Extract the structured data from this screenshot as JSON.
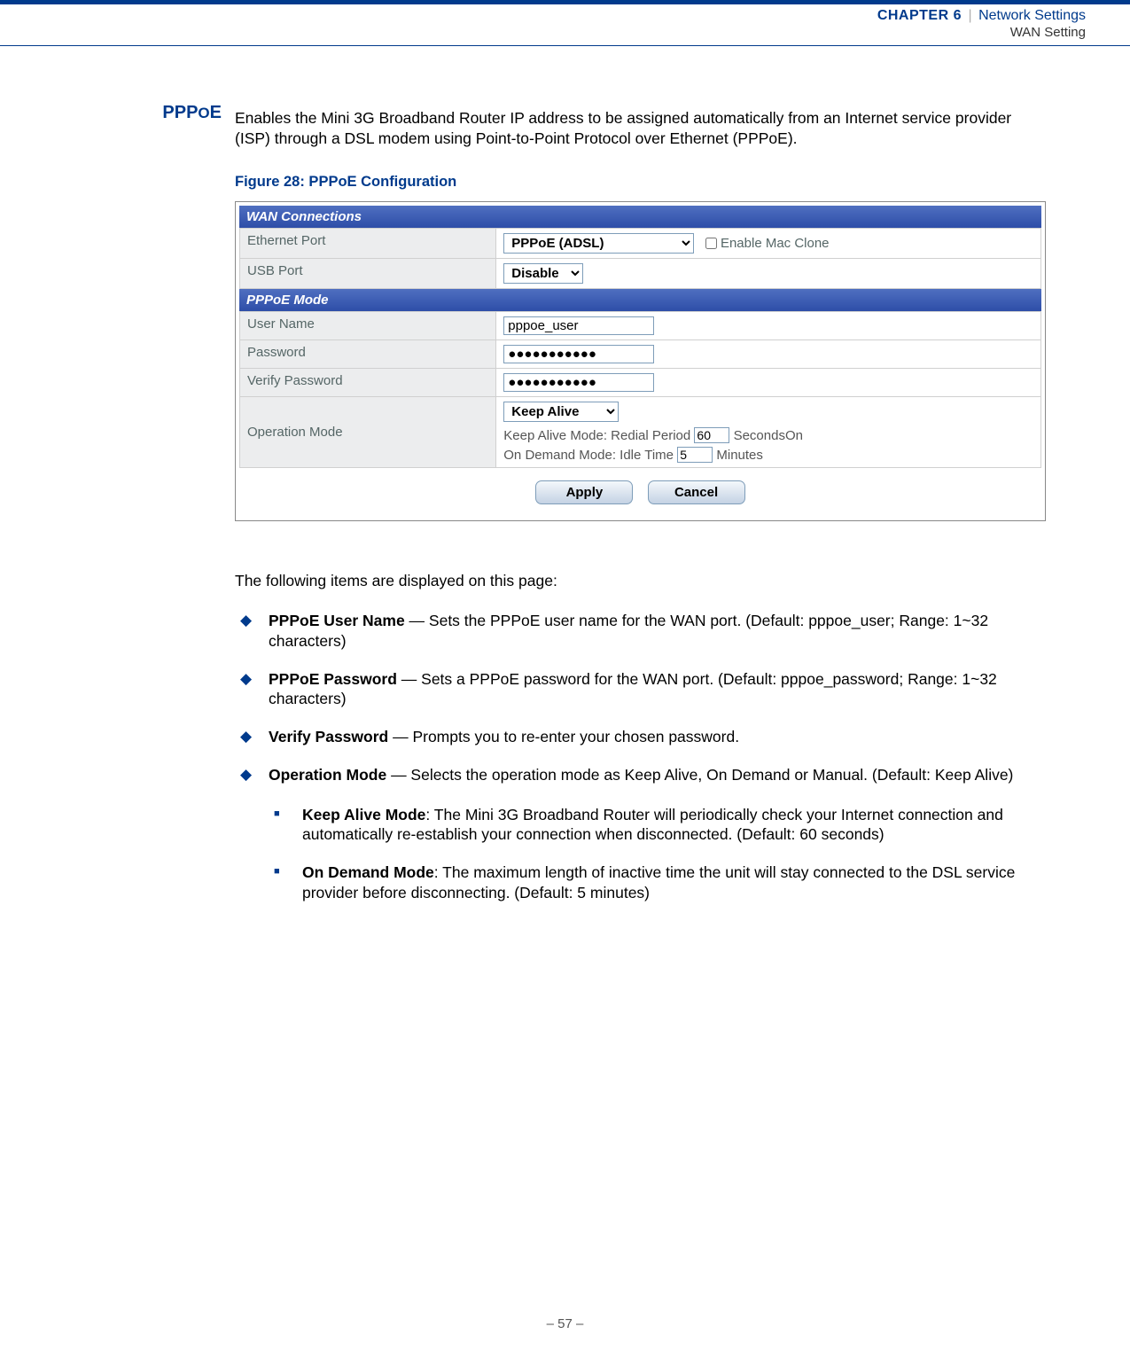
{
  "header": {
    "chapter": "CHAPTER 6",
    "sep": "|",
    "title": "Network Settings",
    "subtitle": "WAN Setting"
  },
  "sideheading_a": "PPP",
  "sideheading_b": "O",
  "sideheading_c": "E",
  "intro": "Enables the Mini 3G Broadband Router IP address to be assigned automatically from an Internet service provider (ISP) through a DSL modem using Point-to-Point Protocol over Ethernet (PPPoE).",
  "fig_caption": "Figure 28:  PPPoE Configuration",
  "shot": {
    "section1": "WAN Connections",
    "ethport_label": "Ethernet Port",
    "ethport_value": "PPPoE (ADSL)",
    "mac_clone_label": "Enable Mac Clone",
    "usb_label": "USB Port",
    "usb_value": "Disable",
    "section2": "PPPoE Mode",
    "user_label": "User Name",
    "user_value": "pppoe_user",
    "pwd_label": "Password",
    "pwd_value": "●●●●●●●●●●●",
    "vpwd_label": "Verify Password",
    "vpwd_value": "●●●●●●●●●●●",
    "op_label": "Operation Mode",
    "op_value": "Keep Alive",
    "keepalive_prefix": "Keep Alive Mode: Redial Period",
    "keepalive_value": "60",
    "keepalive_suffix": "Seconds",
    "ondemand_prefix": "On Demand Mode: Idle Time",
    "ondemand_value": "5",
    "ondemand_suffix": "Minutes",
    "join_word": "On",
    "apply": "Apply",
    "cancel": "Cancel"
  },
  "after_intro": "The following items are displayed on this page:",
  "bullets": [
    {
      "name": "PPPoE User Name",
      "text": " — Sets the PPPoE user name for the WAN port. (Default: pppoe_user; Range: 1~32 characters)"
    },
    {
      "name": "PPPoE Password",
      "text": " — Sets a PPPoE password for the WAN port. (Default: pppoe_password; Range: 1~32 characters)"
    },
    {
      "name": "Verify Password",
      "text": " — Prompts you to re-enter your chosen password."
    },
    {
      "name": "Operation Mode",
      "text": " — Selects the operation mode as Keep Alive, On Demand or Manual. (Default: Keep Alive)"
    }
  ],
  "sub_bullets": [
    {
      "name": "Keep Alive Mode",
      "text": ": The Mini 3G Broadband Router will periodically check your Internet connection and automatically re-establish your connection when disconnected. (Default: 60 seconds)"
    },
    {
      "name": "On Demand Mode",
      "text": ": The maximum length of inactive time the unit will stay connected to the DSL service provider before disconnecting. (Default: 5 minutes)"
    }
  ],
  "page_prefix": "–  ",
  "page_number": "57",
  "page_suffix": "  –"
}
